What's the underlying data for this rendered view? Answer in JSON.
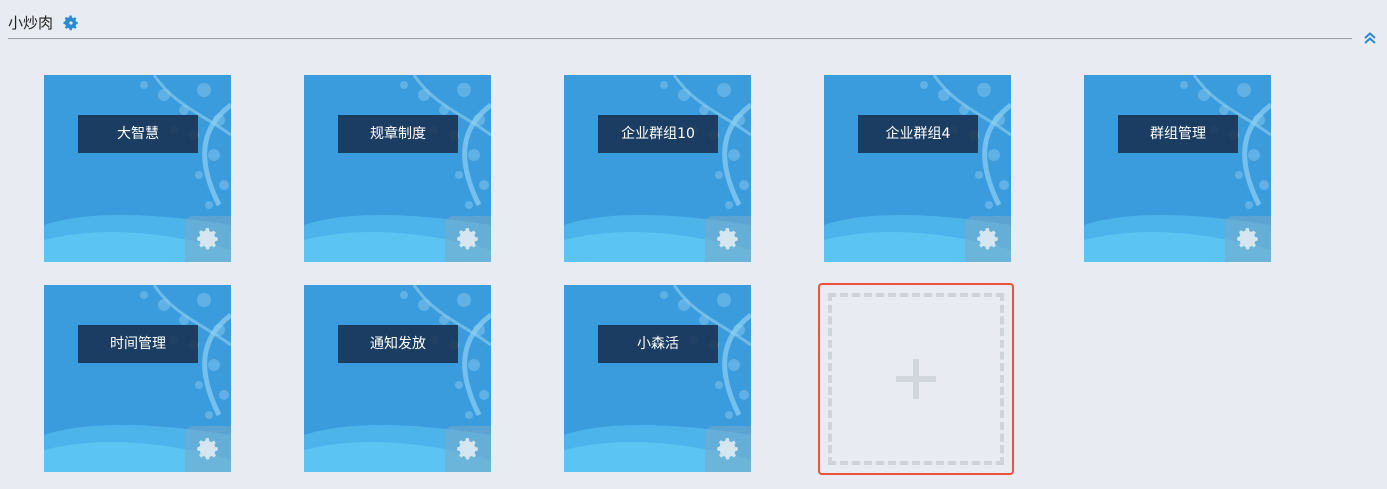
{
  "header": {
    "title": "小炒肉",
    "settings_icon": "gear-icon",
    "collapse_icon": "double-chevron-up-icon",
    "accent_color": "#2a8ad4"
  },
  "tiles": [
    {
      "label": "大智慧"
    },
    {
      "label": "规章制度"
    },
    {
      "label": "企业群组10"
    },
    {
      "label": "企业群组4"
    },
    {
      "label": "群组管理"
    },
    {
      "label": "时间管理"
    },
    {
      "label": "通知发放"
    },
    {
      "label": "小森活"
    }
  ],
  "add_tile": {
    "icon": "plus-icon",
    "highlight_color": "#e8543e"
  }
}
